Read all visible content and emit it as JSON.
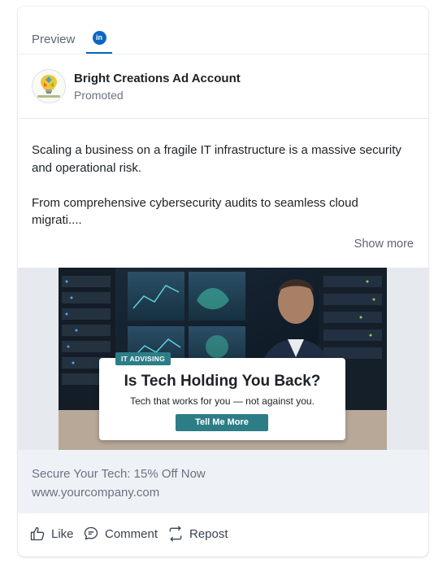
{
  "tabs": {
    "preview_label": "Preview",
    "linkedin_badge": "in",
    "active": "linkedin"
  },
  "account": {
    "name": "Bright Creations Ad Account",
    "subtitle": "Promoted"
  },
  "post": {
    "paragraph1": "Scaling a business on a fragile IT infrastructure is a massive security and operational risk.",
    "paragraph2": "From comprehensive cybersecurity audits to seamless cloud migrati....",
    "show_more": "Show more"
  },
  "creative": {
    "tag": "IT ADVISING",
    "title": "Is Tech Holding You Back?",
    "subtitle": "Tech that works for you — not against you.",
    "cta": "Tell Me More",
    "accent": "#2d7d87"
  },
  "footer": {
    "headline": "Secure Your Tech: 15% Off Now",
    "url": "www.yourcompany.com"
  },
  "actions": {
    "like": "Like",
    "comment": "Comment",
    "repost": "Repost"
  },
  "colors": {
    "linkedin_blue": "#0a66c2",
    "muted_text": "#6b7280",
    "footer_bg": "#eef2f7"
  }
}
